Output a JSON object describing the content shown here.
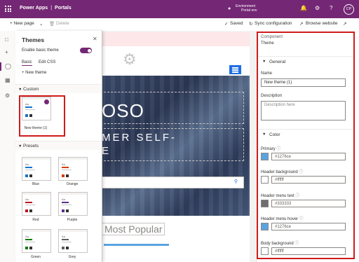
{
  "topbar": {
    "app": "Power Apps",
    "separator": "|",
    "product": "Portals",
    "env_line1": "Environment",
    "env_line2": "Portal env",
    "avatar": "CP"
  },
  "cmdbar": {
    "new_page": "+ New page",
    "delete": "Delete",
    "saved": "Saved",
    "sync": "Sync configuration",
    "browse": "Browse website"
  },
  "panel": {
    "title": "Themes",
    "enable_label": "Enable basic theme",
    "tabs": [
      "Basic",
      "Edit CSS"
    ],
    "new_theme": "+ New theme",
    "custom_heading": "Custom",
    "custom_theme_name": "New theme (1)",
    "presets_heading": "Presets",
    "presets": [
      {
        "name": "Blue",
        "color": "#1276ce"
      },
      {
        "name": "Orange",
        "color": "#d83b01"
      },
      {
        "name": "Red",
        "color": "#c50f1f"
      },
      {
        "name": "Purple",
        "color": "#5c2d91"
      },
      {
        "name": "Green",
        "color": "#107c10"
      },
      {
        "name": "Grey",
        "color": "#605e5c"
      }
    ],
    "card_sample_text": "Aa"
  },
  "canvas": {
    "hero_line1": "OSO",
    "hero_line2": "MER SELF-",
    "hero_line3": "E",
    "most_popular": "Most Popular"
  },
  "props": {
    "component_label": "Component",
    "component_value": "Theme",
    "general_heading": "General",
    "name_label": "Name",
    "name_value": "New theme (1)",
    "description_label": "Description",
    "description_placeholder": "Description here",
    "color_heading": "Color",
    "colors": [
      {
        "label": "Primary",
        "value": "#1276ce",
        "swatch": "#5ba3e0"
      },
      {
        "label": "Header background",
        "value": "#ffffff",
        "swatch": "#ffffff"
      },
      {
        "label": "Header menu text",
        "value": "#333333",
        "swatch": "#6e6e6e"
      },
      {
        "label": "Header menu hover",
        "value": "#1276ce",
        "swatch": "#5ba3e0"
      },
      {
        "label": "Body background",
        "value": "#ffffff",
        "swatch": "#ffffff"
      }
    ]
  }
}
